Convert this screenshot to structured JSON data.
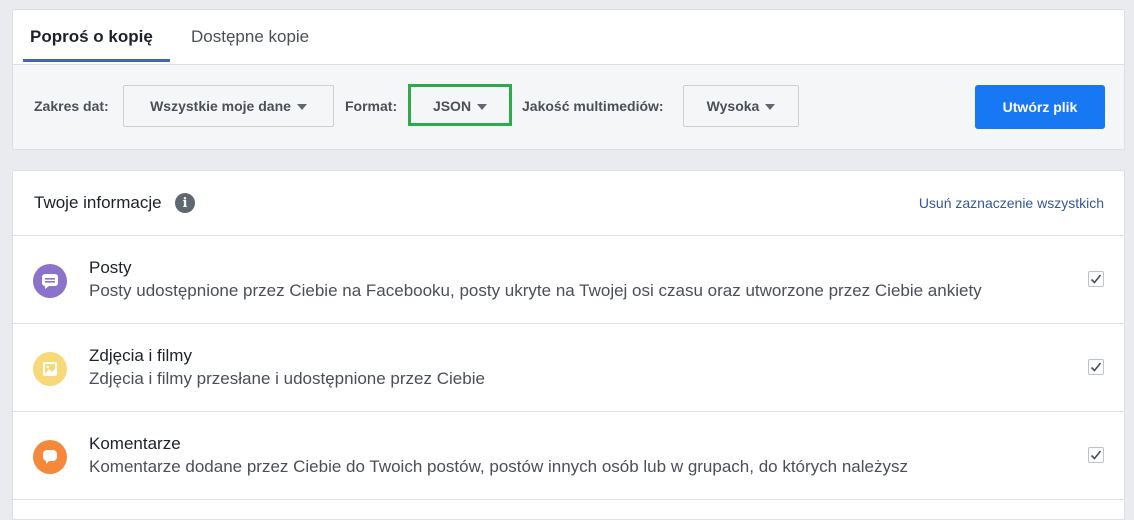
{
  "tabs": [
    {
      "label": "Poproś o kopię",
      "active": true
    },
    {
      "label": "Dostępne kopie",
      "active": false
    }
  ],
  "toolbar": {
    "date_range_label": "Zakres dat:",
    "date_range_value": "Wszystkie moje dane",
    "format_label": "Format:",
    "format_value": "JSON",
    "media_quality_label": "Jakość multimediów:",
    "media_quality_value": "Wysoka",
    "create_button": "Utwórz plik"
  },
  "info_section": {
    "title": "Twoje informacje",
    "deselect_all": "Usuń zaznaczenie wszystkich",
    "items": [
      {
        "title": "Posty",
        "description": "Posty udostępnione przez Ciebie na Facebooku, posty ukryte na Twojej osi czasu oraz utworzone przez Ciebie ankiety",
        "icon": "posts-icon",
        "color": "#8c72cb",
        "checked": true
      },
      {
        "title": "Zdjęcia i filmy",
        "description": "Zdjęcia i filmy przesłane i udostępnione przez Ciebie",
        "icon": "photos-icon",
        "color": "#f7d97a",
        "checked": true
      },
      {
        "title": "Komentarze",
        "description": "Komentarze dodane przez Ciebie do Twoich postów, postów innych osób lub w grupach, do których należysz",
        "icon": "comments-icon",
        "color": "#f5883b",
        "checked": true
      }
    ]
  },
  "colors": {
    "accent": "#4267b2",
    "primary_button": "#1877f2",
    "highlight": "#2eaa4a",
    "link": "#365899"
  }
}
